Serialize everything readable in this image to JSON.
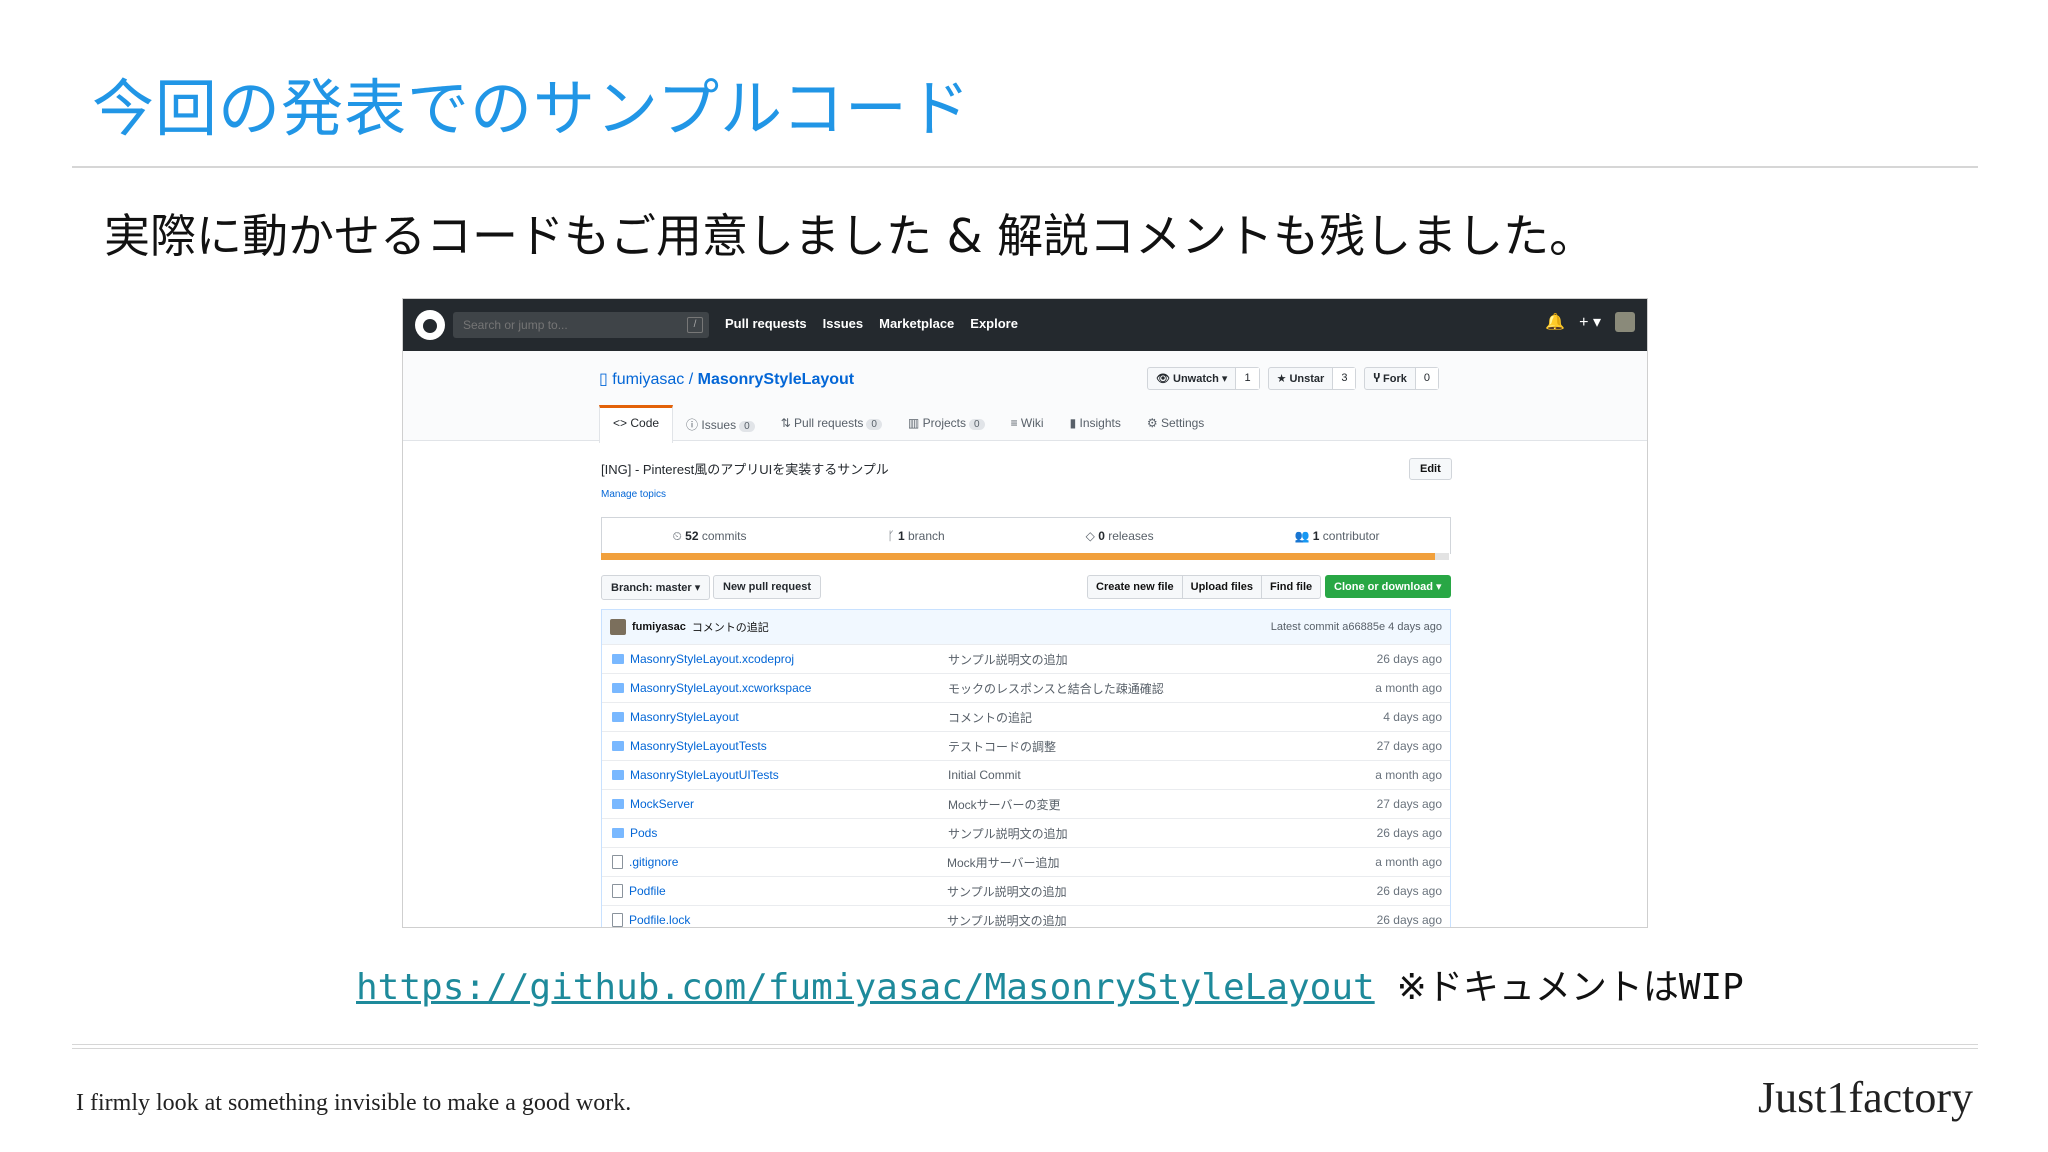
{
  "slide": {
    "title": "今回の発表でのサンプルコード",
    "subtitle": "実際に動かせるコードもご用意しました & 解説コメントも残しました。",
    "url": "https://github.com/fumiyasac/MasonryStyleLayout",
    "url_note": "※ドキュメントはWIP",
    "tagline": "I firmly look at something invisible to make a good work.",
    "brand": "Just1factory"
  },
  "github": {
    "search_placeholder": "Search or jump to...",
    "search_key": "/",
    "nav": [
      "Pull requests",
      "Issues",
      "Marketplace",
      "Explore"
    ],
    "plus": "+ ▾",
    "owner": "fumiyasac",
    "separator": " / ",
    "repo": "MasonryStyleLayout",
    "watch_label": "👁 Unwatch ▾",
    "watch_count": "1",
    "star_label": "★ Unstar",
    "star_count": "3",
    "fork_label": "Ⴤ Fork",
    "fork_count": "0",
    "tabs": {
      "code": "<> Code",
      "issues": "ⓘ Issues",
      "issues_count": "0",
      "pulls": "⇅ Pull requests",
      "pulls_count": "0",
      "projects": "▥ Projects",
      "projects_count": "0",
      "wiki": "≡ Wiki",
      "insights": "▮ Insights",
      "settings": "⚙ Settings"
    },
    "description": "[ING] - Pinterest風のアプリUIを実装するサンプル",
    "manage_topics": "Manage topics",
    "edit": "Edit",
    "commits_num": "52",
    "commits_label": " commits",
    "branch_num": "1",
    "branch_label": " branch",
    "releases_num": "0",
    "releases_label": " releases",
    "contributor_num": "1",
    "contributor_label": " contributor",
    "branch_select": "Branch: master ▾",
    "new_pr": "New pull request",
    "create_file": "Create new file",
    "upload": "Upload files",
    "find": "Find file",
    "clone": "Clone or download ▾",
    "commit_author": "fumiyasac",
    "commit_message": "コメントの追記",
    "latest_commit": "Latest commit a66885e 4 days ago",
    "files": [
      {
        "name": "MasonryStyleLayout.xcodeproj",
        "msg": "サンプル説明文の追加",
        "age": "26 days ago",
        "type": "folder"
      },
      {
        "name": "MasonryStyleLayout.xcworkspace",
        "msg": "モックのレスポンスと結合した疎通確認",
        "age": "a month ago",
        "type": "folder"
      },
      {
        "name": "MasonryStyleLayout",
        "msg": "コメントの追記",
        "age": "4 days ago",
        "type": "folder"
      },
      {
        "name": "MasonryStyleLayoutTests",
        "msg": "テストコードの調整",
        "age": "27 days ago",
        "type": "folder"
      },
      {
        "name": "MasonryStyleLayoutUITests",
        "msg": "Initial Commit",
        "age": "a month ago",
        "type": "folder"
      },
      {
        "name": "MockServer",
        "msg": "Mockサーバーの変更",
        "age": "27 days ago",
        "type": "folder"
      },
      {
        "name": "Pods",
        "msg": "サンプル説明文の追加",
        "age": "26 days ago",
        "type": "folder"
      },
      {
        "name": ".gitignore",
        "msg": "Mock用サーバー追加",
        "age": "a month ago",
        "type": "file"
      },
      {
        "name": "Podfile",
        "msg": "サンプル説明文の追加",
        "age": "26 days ago",
        "type": "file"
      },
      {
        "name": "Podfile.lock",
        "msg": "サンプル説明文の追加",
        "age": "26 days ago",
        "type": "file"
      }
    ]
  }
}
